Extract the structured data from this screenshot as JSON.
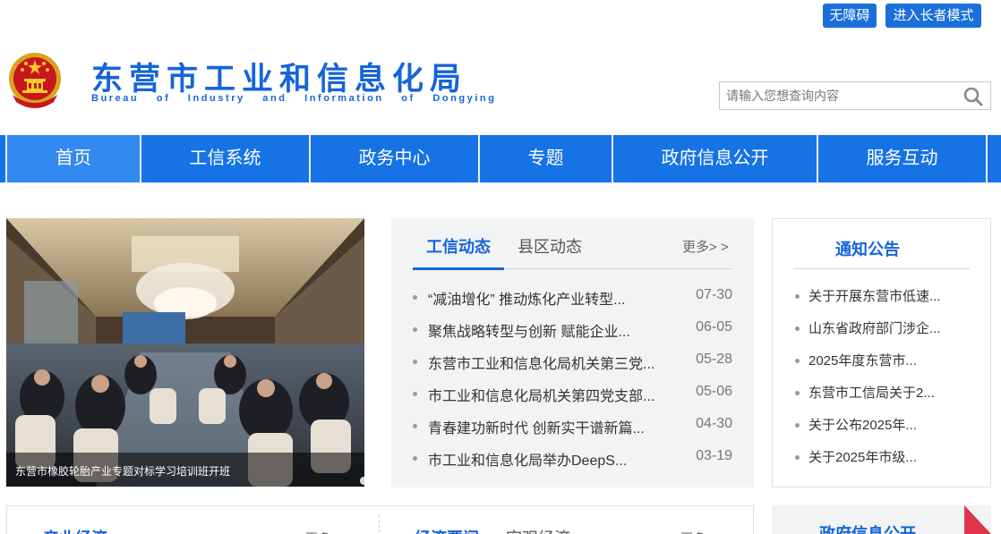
{
  "top_buttons": {
    "accessibility": "无障碍",
    "elder_mode": "进入长者模式"
  },
  "header": {
    "title": "东营市工业和信息化局",
    "subtitle": "Bureau of Industry and Information of Dongying",
    "emblem_icon": "national-emblem-icon"
  },
  "search": {
    "placeholder": "请输入您想查询内容",
    "icon": "search-icon"
  },
  "nav": {
    "items": [
      "首页",
      "工信系统",
      "政务中心",
      "专题",
      "政府信息公开",
      "服务互动"
    ]
  },
  "slider": {
    "caption": "东营市橡胶轮胎产业专题对标学习培训班开班",
    "dot_count": 4,
    "active_dot": 0
  },
  "news": {
    "tabs": [
      "工信动态",
      "县区动态"
    ],
    "active_tab": 0,
    "more": "更多> >",
    "items": [
      {
        "title": "“减油增化” 推动炼化产业转型...",
        "date": "07-30"
      },
      {
        "title": "聚焦战略转型与创新 赋能企业...",
        "date": "06-05"
      },
      {
        "title": "东营市工业和信息化局机关第三党...",
        "date": "05-28"
      },
      {
        "title": "市工业和信息化局机关第四党支部...",
        "date": "05-06"
      },
      {
        "title": "青春建功新时代 创新实干谱新篇...",
        "date": "04-30"
      },
      {
        "title": "市工业和信息化局举办DeepS...",
        "date": "03-19"
      }
    ]
  },
  "notice": {
    "title": "通知公告",
    "items": [
      "关于开展东营市低速...",
      "山东省政府部门涉企...",
      "2025年度东营市...",
      "东营市工信局关于2...",
      "关于公布2025年...",
      "关于2025年市级..."
    ]
  },
  "bottom": {
    "left_tab": "产业经济",
    "left_more": "更多",
    "mid_tab_active": "经济要闻",
    "mid_tab": "宏观经济",
    "mid_more": "更多",
    "right_title": "政府信息公开"
  },
  "colors": {
    "brand_blue": "#1673e6",
    "title_blue": "#1565d8",
    "active_dot": "#4bb54b",
    "flag_red": "#e0344a"
  }
}
